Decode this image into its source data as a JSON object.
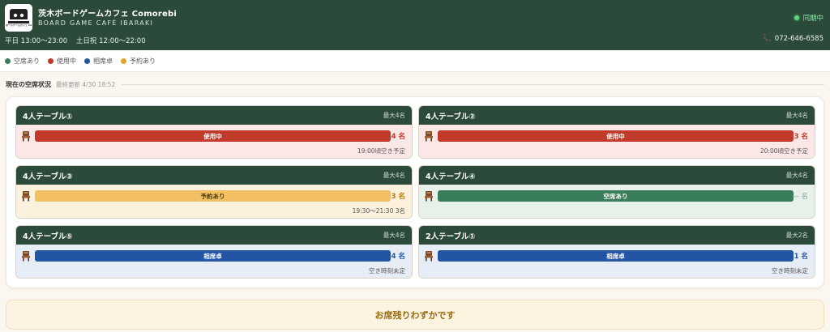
{
  "header": {
    "shop_name": "茨木ボードゲームカフェ Comorebi",
    "shop_subtitle": "BOARD GAME CAFÉ IBARAKI",
    "logo_text": "ボードゲームカフェ Comorebi",
    "weekday_hours": "平日 13:00〜23:00",
    "holiday_hours": "土日祝 12:00〜22:00",
    "sync_status": "同期中",
    "phone": "072-646-6585"
  },
  "legend": [
    {
      "label": "空席あり",
      "color": "#3a7d5a"
    },
    {
      "label": "使用中",
      "color": "#c0392b"
    },
    {
      "label": "相席卓",
      "color": "#2355a3"
    },
    {
      "label": "予約あり",
      "color": "#e0a52a"
    }
  ],
  "section": {
    "title": "現在の空席状況",
    "updated": "最終更新 4/30 18:52"
  },
  "tables": [
    {
      "name": "4人テーブル①",
      "capacity": "最大4名",
      "status": "使用中",
      "count": "4 名",
      "note": "19:00頃空き予定"
    },
    {
      "name": "4人テーブル②",
      "capacity": "最大4名",
      "status": "使用中",
      "count": "3 名",
      "note": "20:00頃空き予定"
    },
    {
      "name": "4人テーブル③",
      "capacity": "最大4名",
      "status": "予約あり",
      "count": "3 名",
      "note": "19:30〜21:30 3名"
    },
    {
      "name": "4人テーブル④",
      "capacity": "最大4名",
      "status": "空席あり",
      "count": "— 名",
      "note": ""
    },
    {
      "name": "4人テーブル⑤",
      "capacity": "最大4名",
      "status": "相席卓",
      "count": "4 名",
      "note": "空き時刻未定"
    },
    {
      "name": "2人テーブル①",
      "capacity": "最大2名",
      "status": "相席卓",
      "count": "1 名",
      "note": "空き時刻未定"
    }
  ],
  "banner": {
    "message": "お席残りわずかです"
  }
}
